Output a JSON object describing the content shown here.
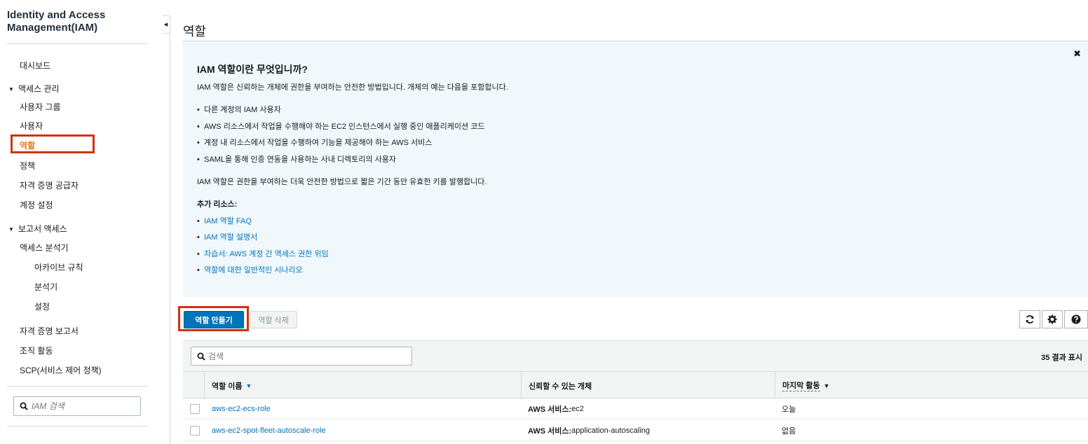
{
  "sidebar": {
    "title_line1": "Identity and Access",
    "title_line2": "Management(IAM)",
    "items": {
      "dashboard": "대시보드",
      "access_mgmt": "액세스 관리",
      "user_groups": "사용자 그룹",
      "users": "사용자",
      "roles": "역할",
      "policies": "정책",
      "identity_providers": "자격 증명 공급자",
      "account_settings": "계정 설정",
      "access_reports": "보고서 액세스",
      "access_analyzer": "액세스 분석기",
      "archive_rules": "아카이브 규칙",
      "analyzers": "분석기",
      "settings": "설정",
      "credential_report": "자격 증명 보고서",
      "org_activity": "조직 활동",
      "scp": "SCP(서비스 제어 정책)"
    },
    "search_placeholder": "IAM 검색"
  },
  "page": {
    "title": "역할"
  },
  "info": {
    "heading": "IAM 역할이란 무엇입니까?",
    "intro": "IAM 역할은 신뢰하는 개체에 권한을 부여하는 안전한 방법입니다. 개체의 예는 다음을 포함합니다.",
    "examples": [
      "다른 계정의 IAM 사용자",
      "AWS 리소스에서 작업을 수행해야 하는 EC2 인스턴스에서 실행 중인 애플리케이션 코드",
      "계정 내 리소스에서 작업을 수행하여 기능을 제공해야 하는 AWS 서비스",
      "SAML을 통해 인증 연동을 사용하는 사내 디렉토리의 사용자"
    ],
    "summary": "IAM 역할은 권한을 부여하는 더욱 안전한 방법으로 짧은 기간 동안 유효한 키를 발행합니다.",
    "resources_heading": "추가 리소스:",
    "links": [
      "IAM 역할 FAQ",
      "IAM 역할 설명서",
      "자습서: AWS 계정 간 액세스 권한 위임",
      "역할에 대한 일반적인 시나리오"
    ],
    "close_icon": "close-icon"
  },
  "toolbar": {
    "create_label": "역할 만들기",
    "delete_label": "역할 삭제"
  },
  "table": {
    "search_placeholder": "검색",
    "result_count": "35 결과 표시",
    "columns": {
      "name": "역할 이름",
      "trusted": "신뢰할 수 있는 개체",
      "last_activity": "마지막 활동"
    },
    "rows": [
      {
        "name": "aws-ec2-ecs-role",
        "trusted_prefix": "AWS 서비스:",
        "trusted_value": " ec2",
        "last_activity": "오늘"
      },
      {
        "name": "aws-ec2-spot-fleet-autoscale-role",
        "trusted_prefix": "AWS 서비스:",
        "trusted_value": " application-autoscaling",
        "last_activity": "없음"
      }
    ]
  },
  "colors": {
    "primary": "#0073bb",
    "active_nav": "#ec7211",
    "highlight": "#d13212",
    "info_bg": "#f1f8fc"
  }
}
